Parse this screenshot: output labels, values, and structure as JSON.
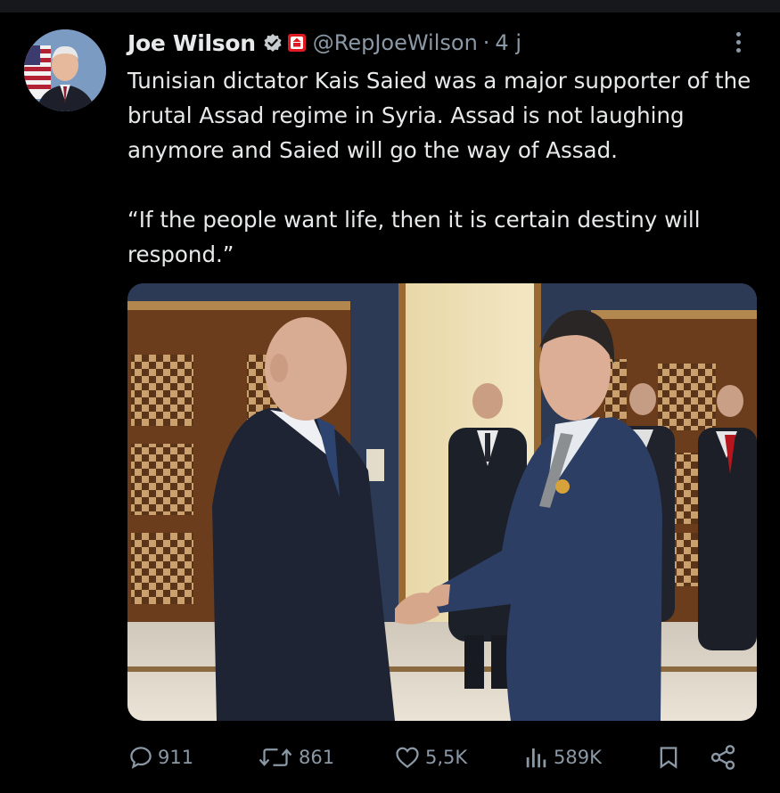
{
  "tweet": {
    "author": {
      "name": "Joe Wilson",
      "handle": "@RepJoeWilson",
      "separator": "·",
      "time": "4 j",
      "verified_icon": "verified-badge-icon",
      "affiliation_icon": "government-seal-icon"
    },
    "text_paragraphs": [
      "Tunisian dictator Kais Saied was a major supporter of the brutal Assad regime in Syria. Assad is not laughing anymore and Saied will go the way of Assad.",
      "“If the people want life, then it is certain destiny will respond.”"
    ],
    "media": {
      "type": "photo",
      "icon": "photo-handshake"
    },
    "stats": {
      "replies": "911",
      "reposts": "861",
      "likes": "5,5K",
      "views": "589K"
    },
    "colors": {
      "background": "#000000",
      "text": "#e7e9ea",
      "secondary": "#8b98a5",
      "verified": "#1d9bf0"
    }
  }
}
